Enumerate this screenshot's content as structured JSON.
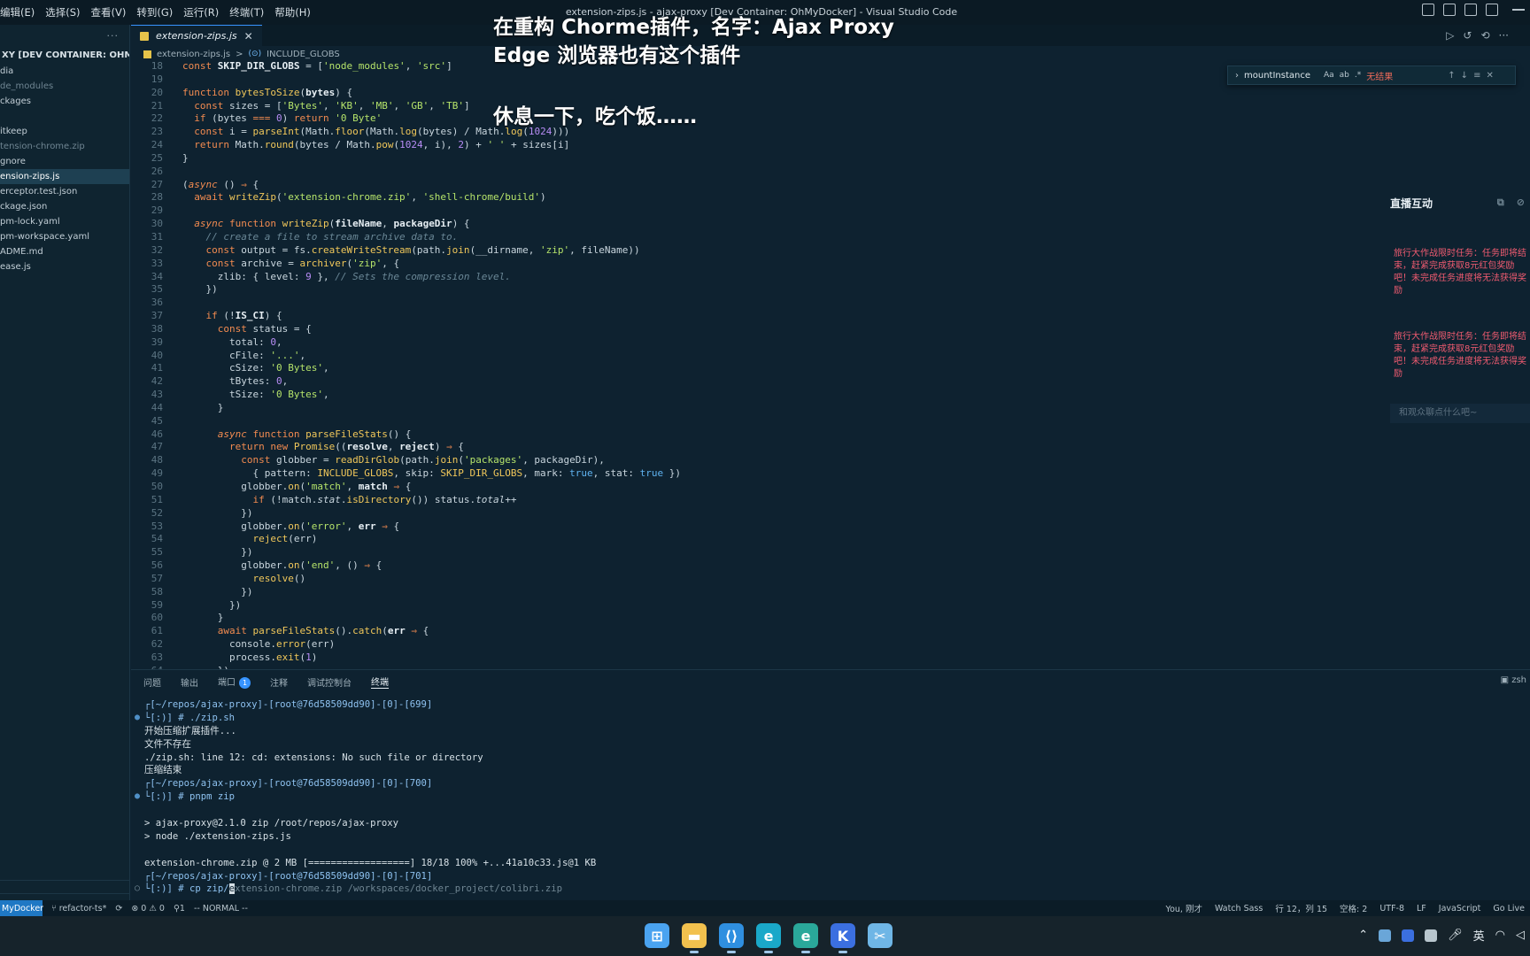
{
  "menubar": {
    "items": [
      "编辑(E)",
      "选择(S)",
      "查看(V)",
      "转到(G)",
      "运行(R)",
      "终端(T)",
      "帮助(H)"
    ],
    "title": "extension-zips.js - ajax-proxy [Dev Container: OhMyDocker] - Visual Studio Code"
  },
  "sidebar": {
    "dots": "···",
    "header": "XY [DEV CONTAINER: OHMYDOCK...",
    "items": [
      {
        "label": "dia",
        "state": "normal"
      },
      {
        "label": "de_modules",
        "state": "dim"
      },
      {
        "label": "ckages",
        "state": "normal"
      },
      {
        "label": "",
        "state": "gap"
      },
      {
        "label": "itkeep",
        "state": "normal"
      },
      {
        "label": "tension-chrome.zip",
        "state": "dim"
      },
      {
        "label": "gnore",
        "state": "normal"
      },
      {
        "label": "ension-zips.js",
        "state": "active"
      },
      {
        "label": "erceptor.test.json",
        "state": "normal"
      },
      {
        "label": "ckage.json",
        "state": "normal"
      },
      {
        "label": "pm-lock.yaml",
        "state": "normal"
      },
      {
        "label": "pm-workspace.yaml",
        "state": "normal"
      },
      {
        "label": "ADME.md",
        "state": "normal"
      },
      {
        "label": "ease.js",
        "state": "normal"
      }
    ]
  },
  "editor": {
    "tab": "extension-zips.js",
    "breadcrumb": {
      "file": "extension-zips.js",
      "separator": ">",
      "symbol": "INCLUDE_GLOBS"
    }
  },
  "find": {
    "query": "mountInstance",
    "options": [
      "Aa",
      "ab",
      ".*"
    ],
    "result": "无结果"
  },
  "overlay": {
    "line1": "在重构 Chorme插件，名字：Ajax Proxy",
    "line2": "Edge 浏览器也有这个插件",
    "line3": "休息一下，吃个饭……"
  },
  "live": {
    "title": "直播互动",
    "messages": [
      "旅行大作战限时任务：任务即将结束，赶紧完成获取8元红包奖励吧！未完成任务进度将无法获得奖励",
      "旅行大作战限时任务：任务即将结束，赶紧完成获取8元红包奖励吧！未完成任务进度将无法获得奖励"
    ],
    "input_placeholder": "和观众聊点什么吧~"
  },
  "panel": {
    "tabs": [
      "问题",
      "输出",
      "端口",
      "注释",
      "调试控制台",
      "终端"
    ],
    "ports_badge": "1",
    "active_tab": "终端",
    "shell": "zsh"
  },
  "terminal": [
    {
      "text": "┌[~/repos/ajax-proxy]-[root@76d58509dd90]-[0]-[699]",
      "kind": "prompt",
      "dot": ""
    },
    {
      "text": "└[:)] # ./zip.sh",
      "kind": "prompt",
      "dot": "●"
    },
    {
      "text": "开始压缩扩展插件...",
      "kind": "out",
      "dot": ""
    },
    {
      "text": "文件不存在",
      "kind": "out",
      "dot": ""
    },
    {
      "text": "./zip.sh: line 12: cd: extensions: No such file or directory",
      "kind": "out",
      "dot": ""
    },
    {
      "text": "压缩结束",
      "kind": "out",
      "dot": ""
    },
    {
      "text": "┌[~/repos/ajax-proxy]-[root@76d58509dd90]-[0]-[700]",
      "kind": "prompt",
      "dot": ""
    },
    {
      "text": "└[:)] # pnpm zip",
      "kind": "prompt",
      "dot": "●"
    },
    {
      "text": "",
      "kind": "out",
      "dot": ""
    },
    {
      "text": "> ajax-proxy@2.1.0 zip /root/repos/ajax-proxy",
      "kind": "out",
      "dot": ""
    },
    {
      "text": "> node ./extension-zips.js",
      "kind": "out",
      "dot": ""
    },
    {
      "text": "",
      "kind": "out",
      "dot": ""
    },
    {
      "text": "extension-chrome.zip @ 2 MB [==================] 18/18 100% +...41a10c33.js@1 KB",
      "kind": "out",
      "dot": ""
    },
    {
      "text": "┌[~/repos/ajax-proxy]-[root@76d58509dd90]-[0]-[701]",
      "kind": "prompt",
      "dot": ""
    }
  ],
  "terminal_last": {
    "prefix": "└[:)] # cp zip/",
    "cursor": "e",
    "ghost": "xtension-chrome.zip /workspaces/docker_project/colibri.zip",
    "dot": "○"
  },
  "statusbar": {
    "remote": "MyDocker",
    "branch": "refactor-ts*",
    "problems": "⊗ 0 ⚠ 0",
    "ports": "1",
    "mode": "-- NORMAL --",
    "blame": "You, 刚才",
    "watch": "Watch Sass",
    "position": "行 12，列 15",
    "spaces": "空格: 2",
    "encoding": "UTF-8",
    "eol": "LF",
    "language": "JavaScript",
    "golive": "Go Live"
  },
  "taskbar": {
    "apps": [
      {
        "name": "windows-start-icon",
        "glyph": "⊞",
        "color": "#4aa3f0"
      },
      {
        "name": "file-explorer-icon",
        "glyph": "▬",
        "color": "#f2c14e"
      },
      {
        "name": "vscode-icon",
        "glyph": "⟨⟩",
        "color": "#2f8fe0"
      },
      {
        "name": "edge-icon",
        "glyph": "e",
        "color": "#1aa8c9"
      },
      {
        "name": "edge-dev-icon",
        "glyph": "e",
        "color": "#2aa89a"
      },
      {
        "name": "k-app-icon",
        "glyph": "K",
        "color": "#3b6fe0"
      },
      {
        "name": "snipping-tool-icon",
        "glyph": "✂",
        "color": "#6fb6e6"
      }
    ],
    "ime": "英"
  },
  "code": [
    {
      "n": "18",
      "h": "<span class='k'>const</span> <span class='v'>SKIP_DIR_GLOBS</span> = [<span class='s'>'node_modules'</span>, <span class='s'>'src'</span>]"
    },
    {
      "n": "19",
      "h": ""
    },
    {
      "n": "20",
      "h": "<span class='k'>function</span> <span class='f'>bytesToSize</span>(<span class='v'>bytes</span>) {"
    },
    {
      "n": "21",
      "h": "  <span class='k'>const</span> sizes = [<span class='s'>'Bytes'</span>, <span class='s'>'KB'</span>, <span class='s'>'MB'</span>, <span class='s'>'GB'</span>, <span class='s'>'TB'</span>]"
    },
    {
      "n": "22",
      "h": "  <span class='k'>if</span> (bytes <span class='k'>===</span> <span class='n'>0</span>) <span class='k'>return</span> <span class='s'>'0 Byte'</span>"
    },
    {
      "n": "23",
      "h": "  <span class='k'>const</span> i = <span class='f'>parseInt</span>(Math.<span class='f'>floor</span>(Math.<span class='f'>log</span>(bytes) / Math.<span class='f'>log</span>(<span class='n'>1024</span>)))"
    },
    {
      "n": "24",
      "h": "  <span class='k'>return</span> Math.<span class='f'>round</span>(bytes / Math.<span class='f'>pow</span>(<span class='n'>1024</span>, i), <span class='n'>2</span>) + <span class='s'>' '</span> + sizes[i]"
    },
    {
      "n": "25",
      "h": "}"
    },
    {
      "n": "26",
      "h": ""
    },
    {
      "n": "27",
      "h": "(<span class='it'>async</span> () <span class='k'>⇒</span> {"
    },
    {
      "n": "28",
      "h": "  <span class='k'>await</span> <span class='f'>writeZip</span>(<span class='s'>'extension-chrome.zip'</span>, <span class='s'>'shell-chrome/build'</span>)"
    },
    {
      "n": "29",
      "h": ""
    },
    {
      "n": "30",
      "h": "  <span class='it'>async</span> <span class='k'>function</span> <span class='f'>writeZip</span>(<span class='v'>fileName</span>, <span class='v'>packageDir</span>) {"
    },
    {
      "n": "31",
      "h": "    <span class='c'>// create a file to stream archive data to.</span>"
    },
    {
      "n": "32",
      "h": "    <span class='k'>const</span> output = fs.<span class='f'>createWriteStream</span>(path.<span class='f'>join</span>(__dirname, <span class='s'>'zip'</span>, fileName))"
    },
    {
      "n": "33",
      "h": "    <span class='k'>const</span> archive = <span class='f'>archiver</span>(<span class='s'>'zip'</span>, {"
    },
    {
      "n": "34",
      "h": "      zlib: { level: <span class='n'>9</span> }, <span class='c'>// Sets the compression level.</span>"
    },
    {
      "n": "35",
      "h": "    })"
    },
    {
      "n": "36",
      "h": ""
    },
    {
      "n": "37",
      "h": "    <span class='k'>if</span> (!<span class='v'>IS_CI</span>) {"
    },
    {
      "n": "38",
      "h": "      <span class='k'>const</span> status = {"
    },
    {
      "n": "39",
      "h": "        total: <span class='n'>0</span>,"
    },
    {
      "n": "40",
      "h": "        cFile: <span class='s'>'...'</span>,"
    },
    {
      "n": "41",
      "h": "        cSize: <span class='s'>'0 Bytes'</span>,"
    },
    {
      "n": "42",
      "h": "        tBytes: <span class='n'>0</span>,"
    },
    {
      "n": "43",
      "h": "        tSize: <span class='s'>'0 Bytes'</span>,"
    },
    {
      "n": "44",
      "h": "      }"
    },
    {
      "n": "45",
      "h": ""
    },
    {
      "n": "46",
      "h": "      <span class='it'>async</span> <span class='k'>function</span> <span class='f'>parseFileStats</span>() {"
    },
    {
      "n": "47",
      "h": "        <span class='k'>return new</span> <span class='f'>Promise</span>((<span class='v'>resolve</span>, <span class='v'>reject</span>) <span class='k'>⇒</span> {"
    },
    {
      "n": "48",
      "h": "          <span class='k'>const</span> globber = <span class='f'>readDirGlob</span>(path.<span class='f'>join</span>(<span class='s'>'packages'</span>, packageDir),"
    },
    {
      "n": "49",
      "h": "            { pattern: <span class='f'>INCLUDE_GLOBS</span>, skip: <span class='f'>SKIP_DIR_GLOBS</span>, mark: <span class='p'>true</span>, stat: <span class='p'>true</span> })"
    },
    {
      "n": "50",
      "h": "          globber.<span class='f'>on</span>(<span class='s'>'match'</span>, <span class='v'>match</span> <span class='k'>⇒</span> {"
    },
    {
      "n": "51",
      "h": "            <span class='k'>if</span> (!match.<span class='ai'>stat</span>.<span class='f'>isDirectory</span>()) status.<span class='ai'>total</span>++"
    },
    {
      "n": "52",
      "h": "          })"
    },
    {
      "n": "53",
      "h": "          globber.<span class='f'>on</span>(<span class='s'>'error'</span>, <span class='v'>err</span> <span class='k'>⇒</span> {"
    },
    {
      "n": "54",
      "h": "            <span class='f'>reject</span>(err)"
    },
    {
      "n": "55",
      "h": "          })"
    },
    {
      "n": "56",
      "h": "          globber.<span class='f'>on</span>(<span class='s'>'end'</span>, () <span class='k'>⇒</span> {"
    },
    {
      "n": "57",
      "h": "            <span class='f'>resolve</span>()"
    },
    {
      "n": "58",
      "h": "          })"
    },
    {
      "n": "59",
      "h": "        })"
    },
    {
      "n": "60",
      "h": "      }"
    },
    {
      "n": "61",
      "h": "      <span class='k'>await</span> <span class='f'>parseFileStats</span>().<span class='f'>catch</span>(<span class='v'>err</span> <span class='k'>⇒</span> {"
    },
    {
      "n": "62",
      "h": "        console.<span class='f'>error</span>(err)"
    },
    {
      "n": "63",
      "h": "        process.<span class='f'>exit</span>(<span class='n'>1</span>)"
    },
    {
      "n": "64",
      "h": "      })"
    }
  ]
}
